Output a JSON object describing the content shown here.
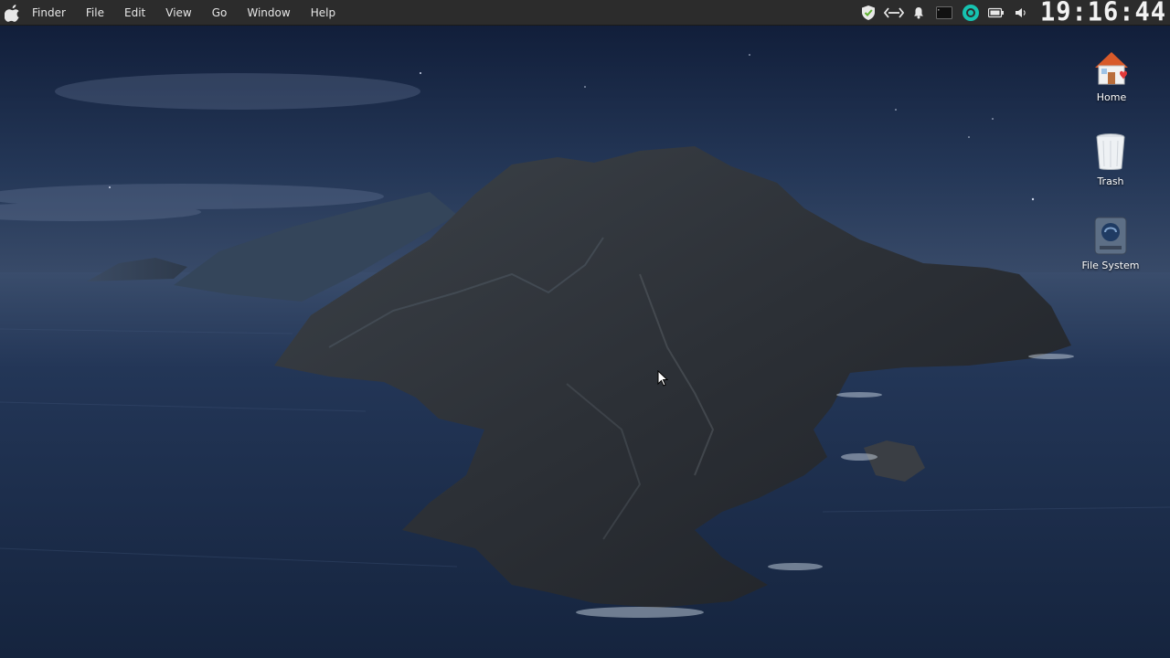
{
  "menubar": {
    "apple_icon": "apple-logo-icon",
    "items": [
      "Finder",
      "File",
      "Edit",
      "View",
      "Go",
      "Window",
      "Help"
    ],
    "tray_icons": [
      "shield-check-icon",
      "network-arrows-icon",
      "bell-icon",
      "terminal-icon",
      "steam-icon",
      "battery-icon",
      "volume-icon"
    ],
    "clock": "19:16:44"
  },
  "desktop": {
    "icons": [
      {
        "label": "Home",
        "icon": "home-folder-icon"
      },
      {
        "label": "Trash",
        "icon": "trash-icon"
      },
      {
        "label": "File System",
        "icon": "hard-drive-icon"
      }
    ]
  },
  "colors": {
    "menubar_bg": "#2c2c2c",
    "sky_top": "#0f1a33",
    "sea": "#1d2f4f",
    "accent_green": "#6fbf3a",
    "accent_teal": "#16c2b0"
  }
}
